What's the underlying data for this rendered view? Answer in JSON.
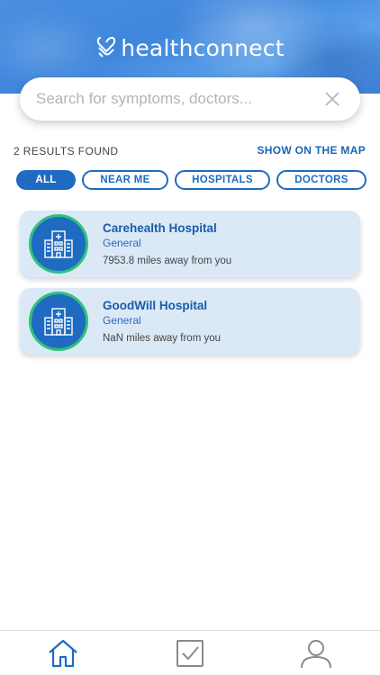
{
  "header": {
    "brand": "healthconnect"
  },
  "search": {
    "placeholder": "Search for symptoms, doctors...",
    "value": ""
  },
  "results": {
    "count_label": "2 RESULTS FOUND",
    "map_link": "SHOW ON THE MAP"
  },
  "filters": [
    {
      "label": "ALL",
      "active": true
    },
    {
      "label": "NEAR ME",
      "active": false
    },
    {
      "label": "HOSPITALS",
      "active": false
    },
    {
      "label": "DOCTORS",
      "active": false
    }
  ],
  "hospitals": [
    {
      "name": "Carehealth Hospital",
      "type": "General",
      "distance": "7953.8 miles away from you"
    },
    {
      "name": "GoodWill Hospital",
      "type": "General",
      "distance": "NaN miles away from you"
    }
  ],
  "nav": [
    {
      "icon": "home-icon",
      "active": true
    },
    {
      "icon": "checkbox-icon",
      "active": false
    },
    {
      "icon": "profile-icon",
      "active": false
    }
  ],
  "colors": {
    "brand_blue": "#1f6bc2",
    "card_bg": "#dbe9f7",
    "avatar_ring": "#2ec27a",
    "nav_active": "#1f6bc2",
    "nav_inactive": "#8a8a8a"
  }
}
